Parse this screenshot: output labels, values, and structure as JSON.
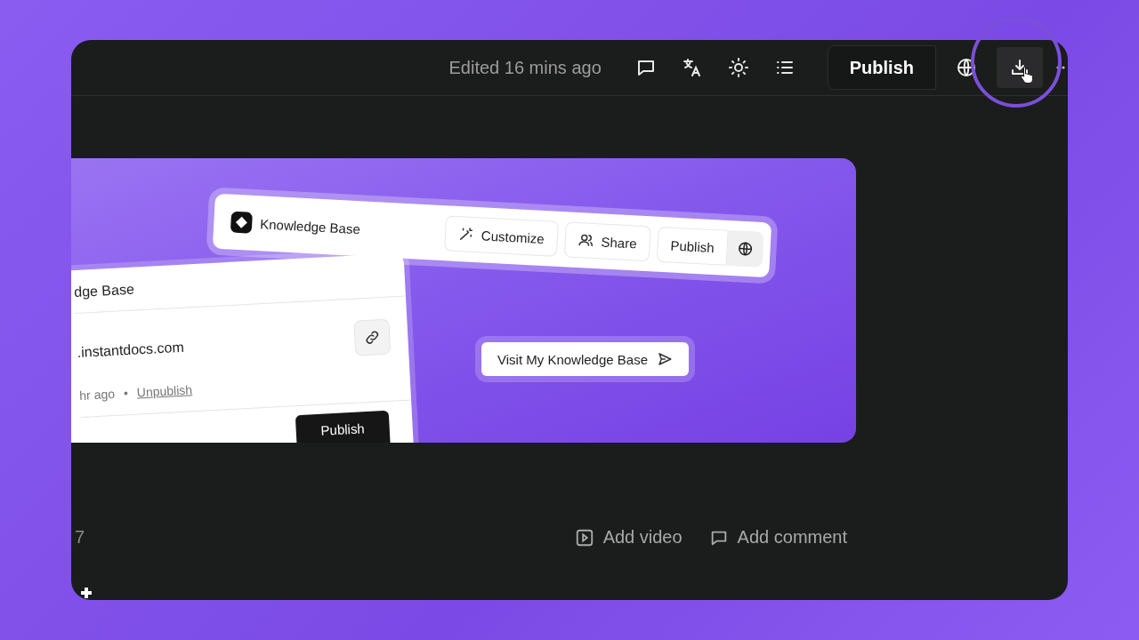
{
  "header": {
    "status": "Edited 16 mins ago",
    "tools": [
      {
        "kind": "comment"
      },
      {
        "kind": "translate"
      },
      {
        "kind": "theme"
      },
      {
        "kind": "outline"
      }
    ],
    "publish_label": "Publish",
    "actions": [
      {
        "kind": "globe",
        "highlighted": false
      },
      {
        "kind": "download",
        "highlighted": true
      },
      {
        "kind": "more",
        "highlighted": false
      }
    ]
  },
  "preview": {
    "settings_card": {
      "title": "dge Base",
      "url": ".instantdocs.com",
      "meta": "hr ago",
      "separator": "•",
      "unpublish_link": "Unpublish",
      "publish_button": "Publish"
    },
    "toolbar_card": {
      "title": "Knowledge Base",
      "buttons": [
        {
          "kind": "customize",
          "label": "Customize"
        },
        {
          "kind": "share",
          "label": "Share"
        },
        {
          "kind": "publish",
          "label": "Publish"
        }
      ]
    },
    "visit_button": "Visit My Knowledge Base"
  },
  "footer": {
    "left_fragment": "7",
    "actions": [
      {
        "kind": "video",
        "label": "Add video"
      },
      {
        "kind": "comment",
        "label": "Add comment"
      }
    ]
  }
}
